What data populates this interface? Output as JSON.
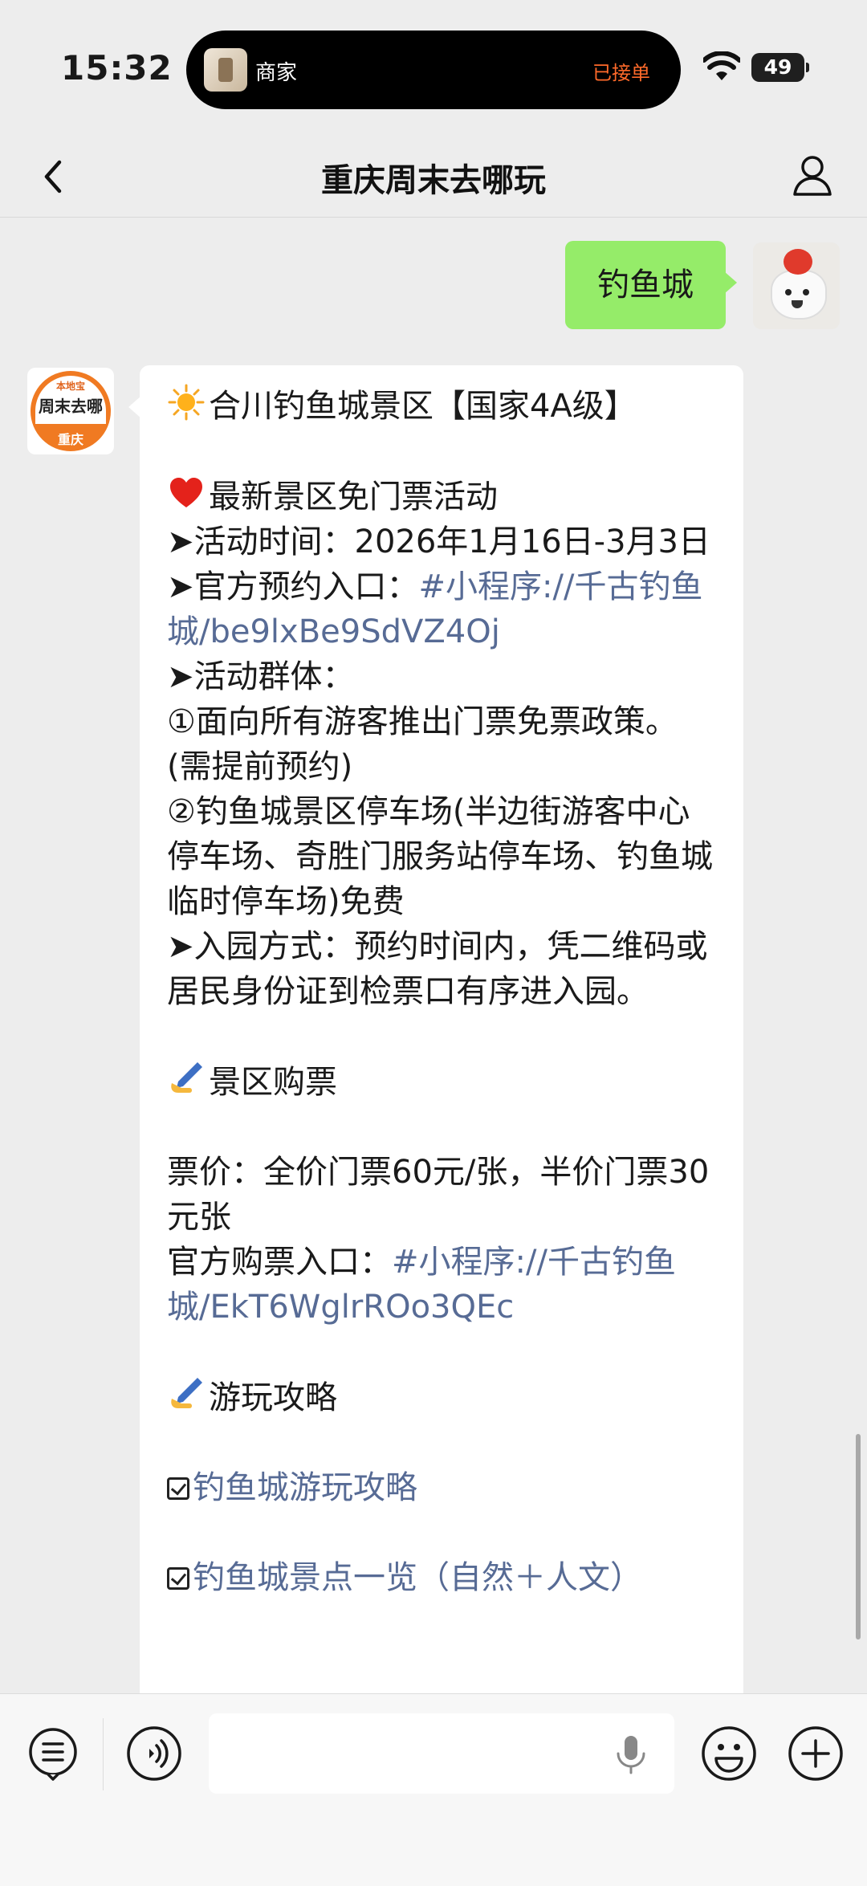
{
  "status_bar": {
    "time": "15:32",
    "island_label": "商家",
    "island_status": "已接单",
    "battery": "49"
  },
  "nav": {
    "title": "重庆周末去哪玩",
    "back_icon": "chevron-left-icon",
    "profile_icon": "person-icon"
  },
  "chat": {
    "user_message": "钓鱼城",
    "bot_avatar": {
      "top_text": "本地宝",
      "mid_text": "周末去哪",
      "bottom_text": "重庆"
    },
    "bot_message": {
      "title": "合川钓鱼城景区【国家4A级】",
      "section1_heading": "最新景区免门票活动",
      "activity_time": "➤活动时间：2026年1月16日-3月3日",
      "official_entry_label": "➤官方预约入口：",
      "official_entry_link": "#小程序://千古钓鱼城/be9lxBe9SdVZ4Oj",
      "group_label": "➤活动群体：",
      "group_item1": "①面向所有游客推出门票免票政策。(需提前预约)",
      "group_item2": "②钓鱼城景区停车场(半边街游客中心停车场、奇胜门服务站停车场、钓鱼城临时停车场)免费",
      "entry_method": "➤入园方式：预约时间内，凭二维码或居民身份证到检票口有序进入园。",
      "section2_heading": "景区购票",
      "price": "票价：全价门票60元/张，半价门票30元张",
      "purchase_label": "官方购票入口：",
      "purchase_link": "#小程序://千古钓鱼城/EkT6WglrROo3QEc",
      "section3_heading": "游玩攻略",
      "guide_link1": "钓鱼城游玩攻略",
      "guide_link2": "钓鱼城景点一览（自然＋人文）"
    }
  },
  "input_bar": {
    "menu_icon": "menu-list-icon",
    "voice_icon": "voice-icon",
    "mic_icon": "microphone-icon",
    "emoji_icon": "emoji-icon",
    "plus_icon": "plus-icon"
  }
}
